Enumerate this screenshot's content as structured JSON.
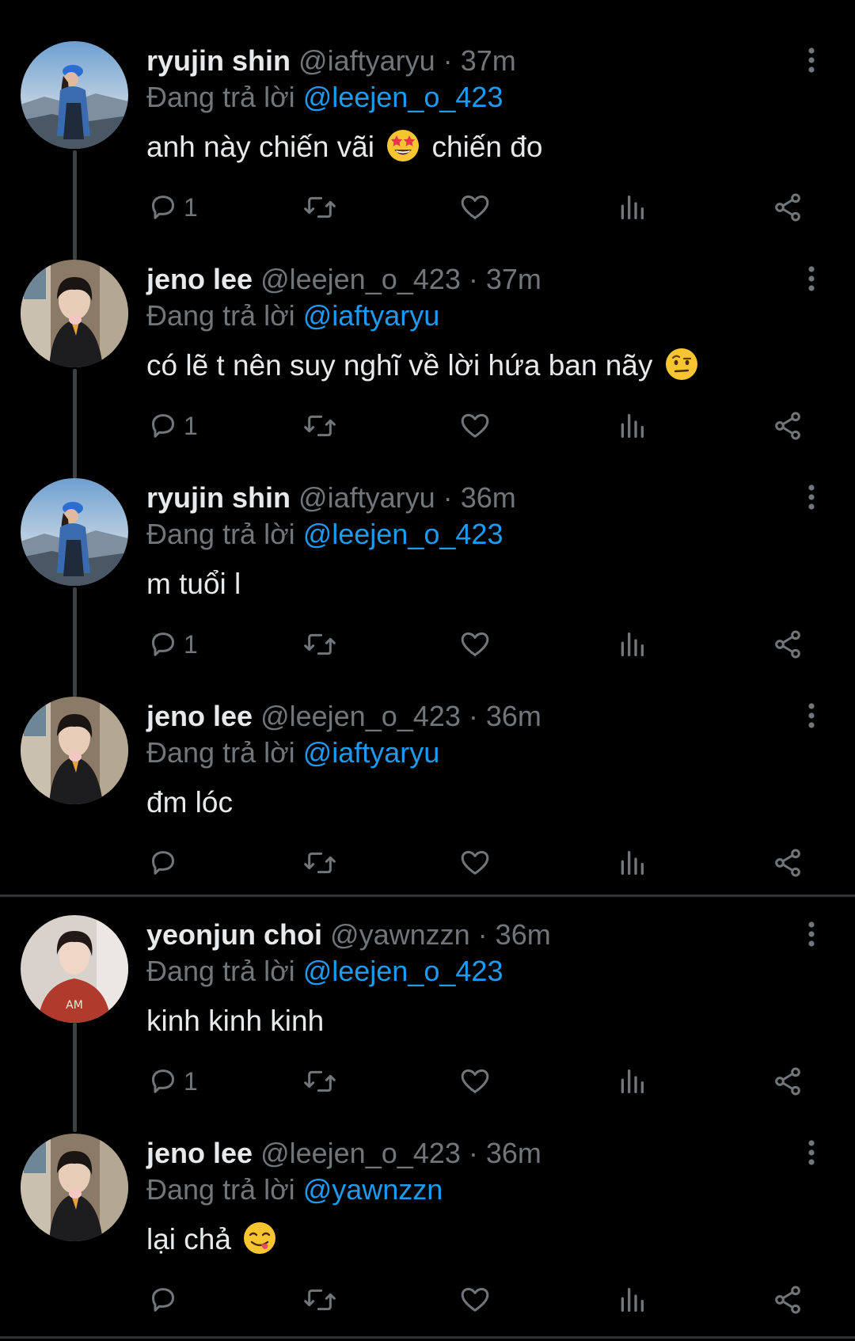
{
  "reply_prefix": "Đang trả lời",
  "colors": {
    "background": "#000000",
    "text": "#e7e9ea",
    "muted": "#71767b",
    "link": "#1d9bf0"
  },
  "tweets": [
    {
      "name": "ryujin shin",
      "handle": "@iaftyaryu",
      "time": "37m",
      "reply_to": "@leejen_o_423",
      "text_before_emoji": "anh này chiến vãi",
      "emoji": "star-struck-emoji",
      "text_after_emoji": "chiến đo",
      "reply_count": "1"
    },
    {
      "name": "jeno lee",
      "handle": "@leejen_o_423",
      "time": "37m",
      "reply_to": "@iaftyaryu",
      "text_before_emoji": "có lẽ t nên suy nghĩ về lời hứa ban nãy",
      "emoji": "raised-eyebrow-emoji",
      "text_after_emoji": "",
      "reply_count": "1"
    },
    {
      "name": "ryujin shin",
      "handle": "@iaftyaryu",
      "time": "36m",
      "reply_to": "@leejen_o_423",
      "text_before_emoji": "m tuổi l",
      "emoji": "",
      "text_after_emoji": "",
      "reply_count": "1"
    },
    {
      "name": "jeno lee",
      "handle": "@leejen_o_423",
      "time": "36m",
      "reply_to": "@iaftyaryu",
      "text_before_emoji": "đm lóc",
      "emoji": "",
      "text_after_emoji": "",
      "reply_count": ""
    },
    {
      "name": "yeonjun choi",
      "handle": "@yawnzzn",
      "time": "36m",
      "reply_to": "@leejen_o_423",
      "text_before_emoji": "kinh kinh kinh",
      "emoji": "",
      "text_after_emoji": "",
      "reply_count": "1"
    },
    {
      "name": "jeno lee",
      "handle": "@leejen_o_423",
      "time": "36m",
      "reply_to": "@yawnzzn",
      "text_before_emoji": "lại chả",
      "emoji": "yum-emoji",
      "text_after_emoji": "",
      "reply_count": ""
    }
  ]
}
